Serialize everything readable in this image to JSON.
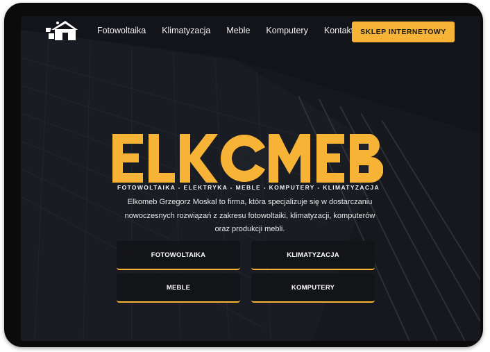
{
  "nav": {
    "logo_icon": "house-solar-logo-icon",
    "links": [
      "Fotowoltaika",
      "Klimatyzacja",
      "Meble",
      "Komputery",
      "Kontakt"
    ],
    "shop_button": "SKLEP INTERNETOWY"
  },
  "hero": {
    "brand": "ELKOMEB",
    "tagline": "FOTOWOLTAIKA - ELEKTRYKA - MEBLE - KOMPUTERY - KLIMATYZACJA",
    "description": "Elkomeb Grzegorz Moskal to firma, która specjalizuje się w dostarczaniu nowoczesnych rozwiązań z zakresu fotowoltaiki, klimatyzacji, komputerów oraz produkcji mebli.",
    "tiles": [
      "FOTOWOLTAIKA",
      "KLIMATYZACJA",
      "MEBLE",
      "KOMPUTERY"
    ]
  },
  "colors": {
    "accent": "#f7b335",
    "background": "#15171c",
    "frame": "#0b0b0c"
  }
}
